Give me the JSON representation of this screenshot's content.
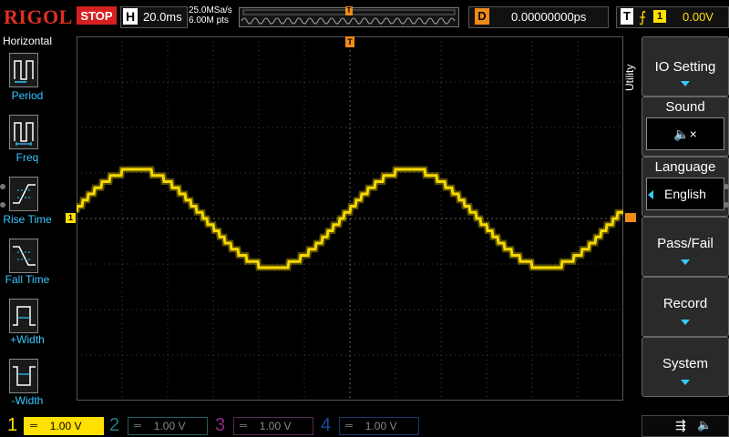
{
  "top": {
    "brand": "RIGOL",
    "run_state": "STOP",
    "horizontal_label": "H",
    "timebase": "20.0ms",
    "sample_rate": "25.0MSa/s",
    "memory_depth": "6.00M pts",
    "trigger_marker": "T",
    "delay_label": "D",
    "delay_value": "0.00000000ps",
    "trigger_label": "T",
    "trigger_source": "1",
    "trigger_level": "0.00V"
  },
  "left_menu": {
    "title": "Horizontal",
    "items": [
      {
        "label": "Period"
      },
      {
        "label": "Freq"
      },
      {
        "label": "Rise Time"
      },
      {
        "label": "Fall Time"
      },
      {
        "label": "+Width"
      },
      {
        "label": "-Width"
      }
    ]
  },
  "right_menu": {
    "title": "Utility",
    "items": [
      {
        "label": "IO Setting"
      },
      {
        "label": "Sound",
        "value": "🔈×"
      },
      {
        "label": "Language",
        "value": "English"
      },
      {
        "label": "Pass/Fail"
      },
      {
        "label": "Record"
      },
      {
        "label": "System"
      }
    ]
  },
  "channels": [
    {
      "num": "1",
      "scale": "1.00 V",
      "color": "#ffe000",
      "active": true
    },
    {
      "num": "2",
      "scale": "1.00 V",
      "color": "#1f7f7f",
      "active": false
    },
    {
      "num": "3",
      "scale": "1.00 V",
      "color": "#8a2a8a",
      "active": false
    },
    {
      "num": "4",
      "scale": "1.00 V",
      "color": "#1a4a9a",
      "active": false
    }
  ],
  "markers": {
    "channel1_ground": "1",
    "trigger_top": "T"
  },
  "colors": {
    "accent": "#38c8ff",
    "trace": "#ffe000",
    "trigger": "#f08a18",
    "stop": "#d42020"
  }
}
